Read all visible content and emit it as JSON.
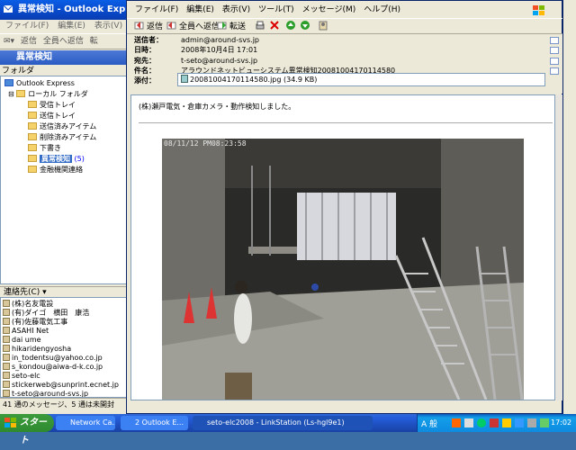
{
  "background_window": {
    "title": "異常検知 - Outlook Express",
    "menu": [
      "ファイル(F)",
      "編集(E)",
      "表示(V)",
      "ツ"
    ],
    "toolbar": [
      "返信",
      "全員へ返信",
      "転"
    ],
    "folder_header": "異常検知",
    "folder_label": "フォルダ",
    "folders": [
      {
        "label": "Outlook Express",
        "count": ""
      },
      {
        "label": "ローカル フォルダ",
        "count": ""
      },
      {
        "label": "受信トレイ",
        "count": ""
      },
      {
        "label": "送信トレイ",
        "count": ""
      },
      {
        "label": "送信済みアイテム",
        "count": ""
      },
      {
        "label": "削除済みアイテム",
        "count": ""
      },
      {
        "label": "下書き",
        "count": ""
      },
      {
        "label": "異常検知",
        "count": "(5)"
      },
      {
        "label": "金融機関連絡",
        "count": ""
      }
    ],
    "contacts_header": "連絡先(C) ▾",
    "contacts": [
      "(株)名友電設",
      "(有)ダイゴ　横田　康浩",
      "(有)佐藤電気工事",
      "ASAHI Net",
      "dai ume",
      "hikaridengyosha",
      "in_todentsu@yahoo.co.jp",
      "s_kondou@aiwa-d-k.co.jp",
      "seto-elc",
      "stickerweb@sunprint.ecnet.jp",
      "t-seto@around-svs.jp"
    ],
    "status": "41 通のメッセージ、5 通は未開封"
  },
  "message_window": {
    "menu": [
      "ファイル(F)",
      "編集(E)",
      "表示(V)",
      "ツール(T)",
      "メッセージ(M)",
      "ヘルプ(H)"
    ],
    "toolbar": {
      "reply": "返信",
      "reply_all": "全員へ返信",
      "forward": "転送"
    },
    "header": {
      "from_label": "送信者：",
      "from": "admin@around-svs.jp",
      "date_label": "日時：",
      "date": "2008年10月4日 17:01",
      "to_label": "宛先：",
      "to": "t-seto@around-svs.jp",
      "subject_label": "件名：",
      "subject": "アラウンドネットビューシステム異常検知20081004170114580",
      "attachment_label": "添付：",
      "attachment": "20081004170114580.jpg (34.9 KB)"
    },
    "body_text": "(株)瀬戸電気・倉庫カメラ・動作検知しました。",
    "photo_timestamp": "08/11/12 PM08:23:58"
  },
  "taskbar": {
    "start": "スタート",
    "tasks": [
      "Network Ca...",
      "2 Outlook E...",
      "seto-elc2008 - LinkStation (Ls-hgl9e1)"
    ],
    "tray_text": "A 般",
    "clock": "17:02"
  }
}
